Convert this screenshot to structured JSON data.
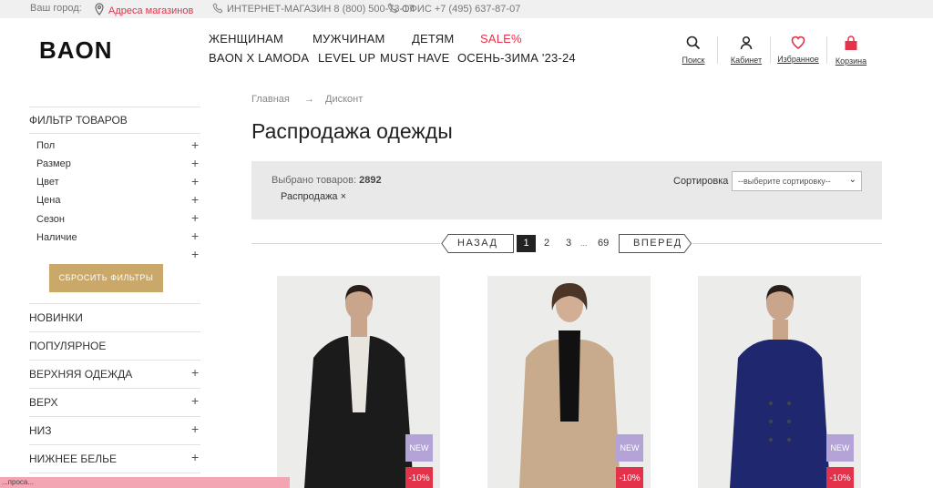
{
  "topbar": {
    "city_label": "Ваш город:",
    "stores_link": "Адреса магазинов",
    "shop_phone": "ИНТЕРНЕТ-МАГАЗИН 8 (800) 500-73-17",
    "office_phone": "ОФИС +7 (495) 637-87-07"
  },
  "header": {
    "logo": "BAON",
    "nav": [
      "ЖЕНЩИНАМ",
      "МУЖЧИНАМ",
      "ДЕТЯМ",
      "SALE%",
      "BAON X LAMODA",
      "LEVEL UP",
      "MUST HAVE",
      "ОСЕНЬ-ЗИМА '23-24"
    ],
    "icons": [
      {
        "label": "Поиск",
        "icon": "search-icon"
      },
      {
        "label": "Кабинет",
        "icon": "user-icon"
      },
      {
        "label": "Избранное",
        "icon": "heart-icon"
      },
      {
        "label": "Корзина",
        "icon": "bag-icon"
      }
    ]
  },
  "sidebar": {
    "filter_title": "ФИЛЬТР ТОВАРОВ",
    "filters": [
      "Пол",
      "Размер",
      "Цвет",
      "Цена",
      "Сезон",
      "Наличие"
    ],
    "reset_label": "СБРОСИТЬ ФИЛЬТРЫ",
    "categories": [
      "НОВИНКИ",
      "ПОПУЛЯРНОЕ",
      "ВЕРХНЯЯ ОДЕЖДА",
      "ВЕРХ",
      "НИЗ",
      "НИЖНЕЕ БЕЛЬЕ"
    ]
  },
  "breadcrumb": {
    "home": "Главная",
    "arrow": "→",
    "current": "Дисконт"
  },
  "page_title": "Распродажа одежды",
  "results": {
    "count_label": "Выбрано товаров:",
    "count": "2892",
    "active_tag": "Распродажа ×",
    "sort_label": "Сортировка",
    "sort_placeholder": "--выберите сортировку--"
  },
  "pagination": {
    "prev": "НАЗАД",
    "next": "ВПЕРЕД",
    "current": "1",
    "pages": [
      "2",
      "3"
    ],
    "ellipsis": "...",
    "last": "69"
  },
  "products": [
    {
      "badge_new": "NEW",
      "badge_sale": "-10%",
      "colors": {
        "jacket": "#1b1b1b",
        "shirt": "#e8e5df",
        "skin": "#c9a58c",
        "hair": "#2a1e18"
      }
    },
    {
      "badge_new": "NEW",
      "badge_sale": "-10%",
      "colors": {
        "jacket": "#c8ab8c",
        "shirt": "#111111",
        "skin": "#d2ae94",
        "hair": "#4a3526"
      }
    },
    {
      "badge_new": "NEW",
      "badge_sale": "-10%",
      "colors": {
        "jacket": "#1f276e",
        "shirt": "#1f276e",
        "skin": "#c9a58c",
        "hair": "#2a1e18"
      }
    }
  ],
  "status_text": "...проса...",
  "colors": {
    "accent": "#e3324a",
    "reset": "#c9a869",
    "badge_new": "#b3a3d6"
  }
}
